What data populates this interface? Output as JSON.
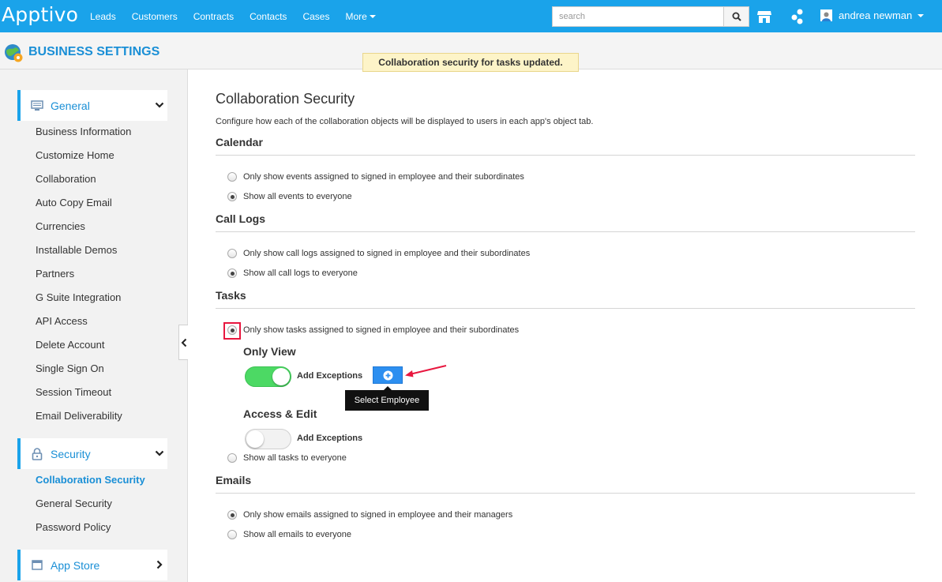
{
  "app": {
    "logo": "Apptivo",
    "nav": [
      "Leads",
      "Customers",
      "Contracts",
      "Contacts",
      "Cases"
    ],
    "more_label": "More",
    "search_placeholder": "search",
    "user_name": "andrea newman",
    "accent_color": "#1aa3ea"
  },
  "header": {
    "title": "BUSINESS SETTINGS",
    "toast": "Collaboration security for tasks updated."
  },
  "sidebar": {
    "general": {
      "label": "General",
      "icon": "monitor-icon",
      "items": [
        "Business Information",
        "Customize Home",
        "Collaboration",
        "Auto Copy Email",
        "Currencies",
        "Installable Demos",
        "Partners",
        "G Suite Integration",
        "API Access",
        "Delete Account",
        "Single Sign On",
        "Session Timeout",
        "Email Deliverability"
      ]
    },
    "security": {
      "label": "Security",
      "icon": "lock-icon",
      "items": [
        "Collaboration Security",
        "General Security",
        "Password Policy"
      ],
      "active_item": "Collaboration Security"
    },
    "app_store": {
      "label": "App Store",
      "icon": "window-icon"
    }
  },
  "main": {
    "title": "Collaboration Security",
    "description": "Configure how each of the collaboration objects will be displayed to users in each app's object tab.",
    "calendar": {
      "title": "Calendar",
      "options": [
        "Only show events assigned to signed in employee and their subordinates",
        "Show all events to everyone"
      ],
      "selected": 1
    },
    "call_logs": {
      "title": "Call Logs",
      "options": [
        "Only show call logs assigned to signed in employee and their subordinates",
        "Show all call logs to everyone"
      ],
      "selected": 1
    },
    "tasks": {
      "title": "Tasks",
      "options": [
        "Only show tasks assigned to signed in employee and their subordinates",
        "Show all tasks to everyone"
      ],
      "selected": 0,
      "only_view": {
        "title": "Only View",
        "exceptions_label": "Add Exceptions",
        "toggle_on": true,
        "tooltip": "Select Employee"
      },
      "access_edit": {
        "title": "Access & Edit",
        "exceptions_label": "Add Exceptions",
        "toggle_on": false
      }
    },
    "emails": {
      "title": "Emails",
      "options": [
        "Only show emails assigned to signed in employee and their managers",
        "Show all emails to everyone"
      ],
      "selected": 0
    }
  }
}
